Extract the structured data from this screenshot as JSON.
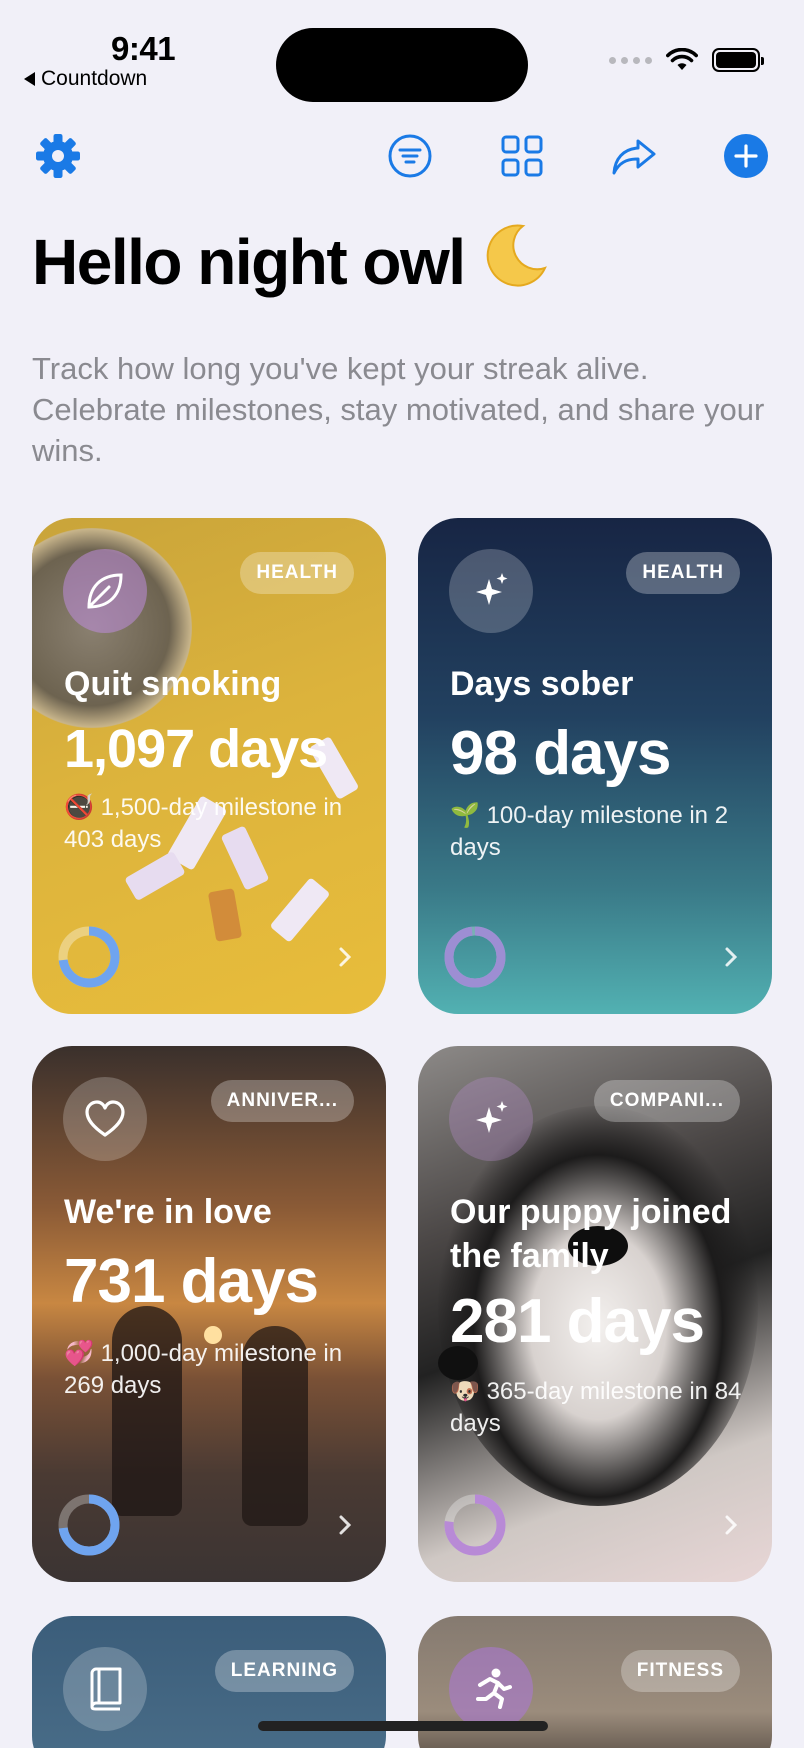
{
  "status_bar": {
    "time": "9:41",
    "back_label": "Countdown"
  },
  "toolbar": {
    "icons": [
      "gear-icon",
      "filter-icon",
      "grid-icon",
      "share-icon",
      "add-icon"
    ],
    "accent_color": "#1a7ae6"
  },
  "header": {
    "title": "Hello night owl",
    "title_emoji": "🌙",
    "subtitle": "Track how long you've kept your streak alive. Celebrate milestones, stay motivated, and share your wins."
  },
  "cards": [
    {
      "badge": "HEALTH",
      "icon": "leaf-icon",
      "name": "Quit smoking",
      "days": "1,097 days",
      "milestone_emoji": "🚭",
      "milestone": "1,500-day milestone in 403 days",
      "progress": 0.73
    },
    {
      "badge": "HEALTH",
      "icon": "sparkles-icon",
      "name": "Days sober",
      "days": "98 days",
      "milestone_emoji": "🌱",
      "milestone": "100-day milestone in 2 days",
      "progress": 0.98
    },
    {
      "badge": "ANNIVER...",
      "icon": "heart-icon",
      "name": "We're in love",
      "days": "731 days",
      "milestone_emoji": "💞",
      "milestone": "1,000-day milestone in 269 days",
      "progress": 0.73
    },
    {
      "badge": "COMPANI...",
      "icon": "sparkles-icon",
      "name": "Our puppy joined the family",
      "days": "281 days",
      "milestone_emoji": "🐶",
      "milestone": "365-day milestone in 84 days",
      "progress": 0.77
    },
    {
      "badge": "LEARNING",
      "icon": "book-icon"
    },
    {
      "badge": "FITNESS",
      "icon": "running-icon"
    }
  ]
}
